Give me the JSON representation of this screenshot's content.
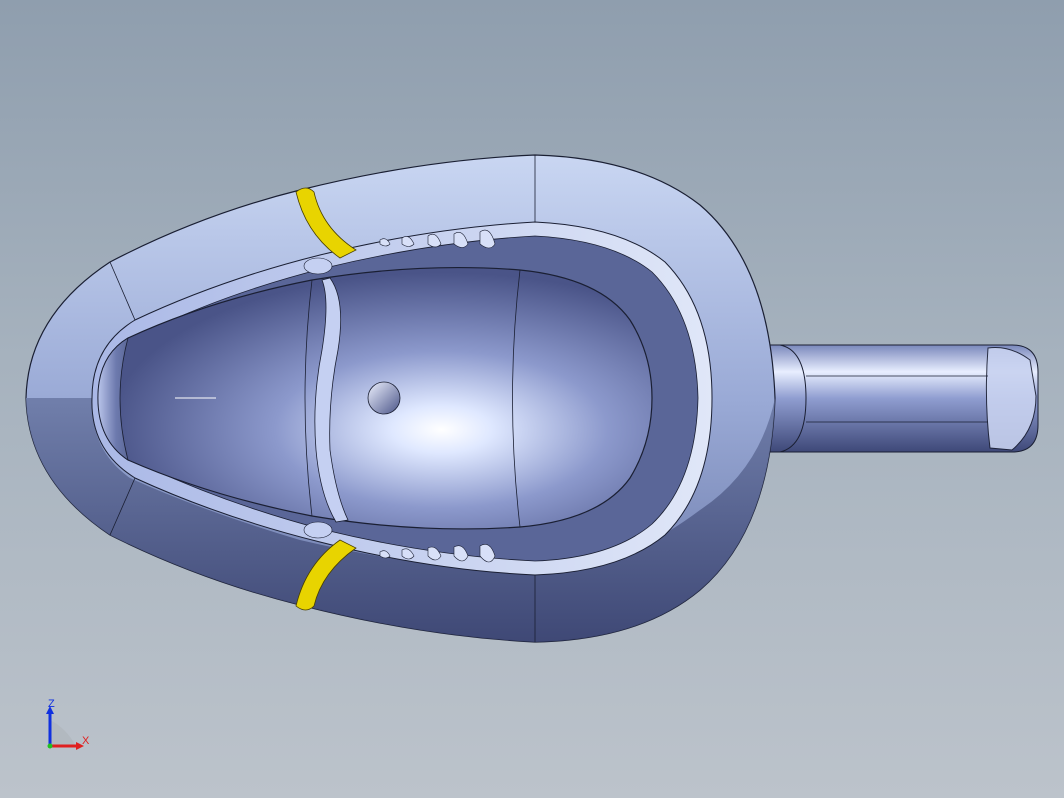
{
  "viewport": {
    "background_top": "#8f9eae",
    "background_bottom": "#bcc3cb"
  },
  "model": {
    "body_color": "#8a98c8",
    "section_color": "#d8e0f0",
    "highlight_color": "#e8d400",
    "edge_color": "#1a1f33"
  },
  "triad": {
    "z_label": "Z",
    "x_label": "X",
    "z_color": "#1030e0",
    "x_color": "#e02020"
  }
}
